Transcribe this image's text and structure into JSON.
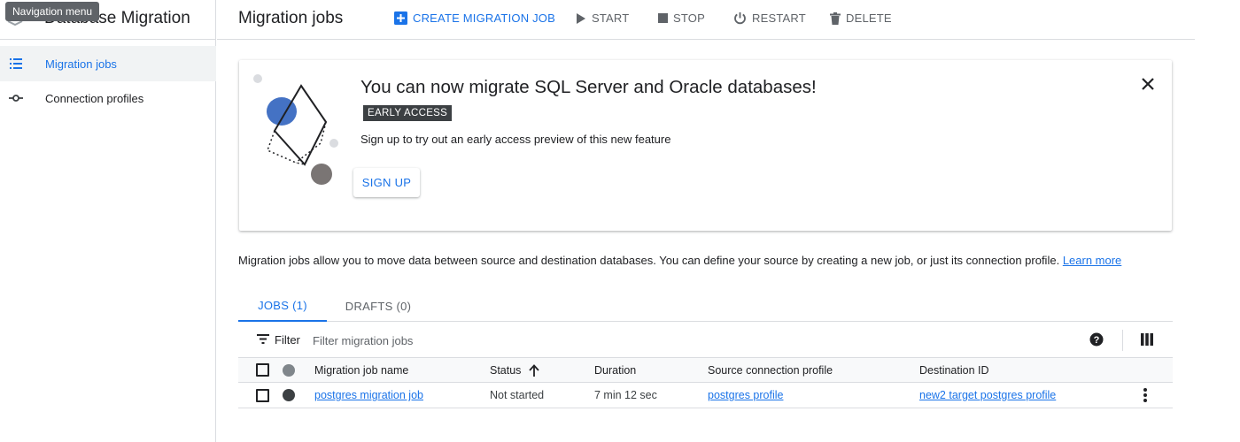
{
  "sidebar": {
    "tooltip": "Navigation menu",
    "product_title": "Database Migration",
    "items": [
      {
        "label": "Migration jobs",
        "icon": "list-icon",
        "active": true
      },
      {
        "label": "Connection profiles",
        "icon": "connection-icon",
        "active": false
      }
    ]
  },
  "toolbar": {
    "page_title": "Migration jobs",
    "create_label": "CREATE MIGRATION JOB",
    "start_label": "START",
    "stop_label": "STOP",
    "restart_label": "RESTART",
    "delete_label": "DELETE"
  },
  "banner": {
    "title": "You can now migrate SQL Server and Oracle databases!",
    "badge": "EARLY ACCESS",
    "subtitle": "Sign up to try out an early access preview of this new feature",
    "signup_label": "SIGN UP"
  },
  "description": {
    "text": "Migration jobs allow you to move data between source and destination databases. You can define your source by creating a new job, or just its connection profile.",
    "link": "Learn more"
  },
  "tabs": [
    {
      "label": "JOBS (1)",
      "active": true
    },
    {
      "label": "DRAFTS (0)",
      "active": false
    }
  ],
  "filter": {
    "label": "Filter",
    "placeholder": "Filter migration jobs"
  },
  "table": {
    "columns": [
      "Migration job name",
      "Status",
      "Duration",
      "Source connection profile",
      "Destination ID"
    ],
    "sort_column": "Status",
    "sort_direction": "ascending",
    "rows": [
      {
        "name": "postgres migration job",
        "status": "Not started",
        "duration": "7 min 12 sec",
        "source": "postgres profile",
        "destination": "new2 target postgres profile"
      }
    ]
  },
  "colors": {
    "accent": "#1a73e8",
    "text": "#202124",
    "muted": "#5f6368",
    "border": "#dadce0"
  }
}
